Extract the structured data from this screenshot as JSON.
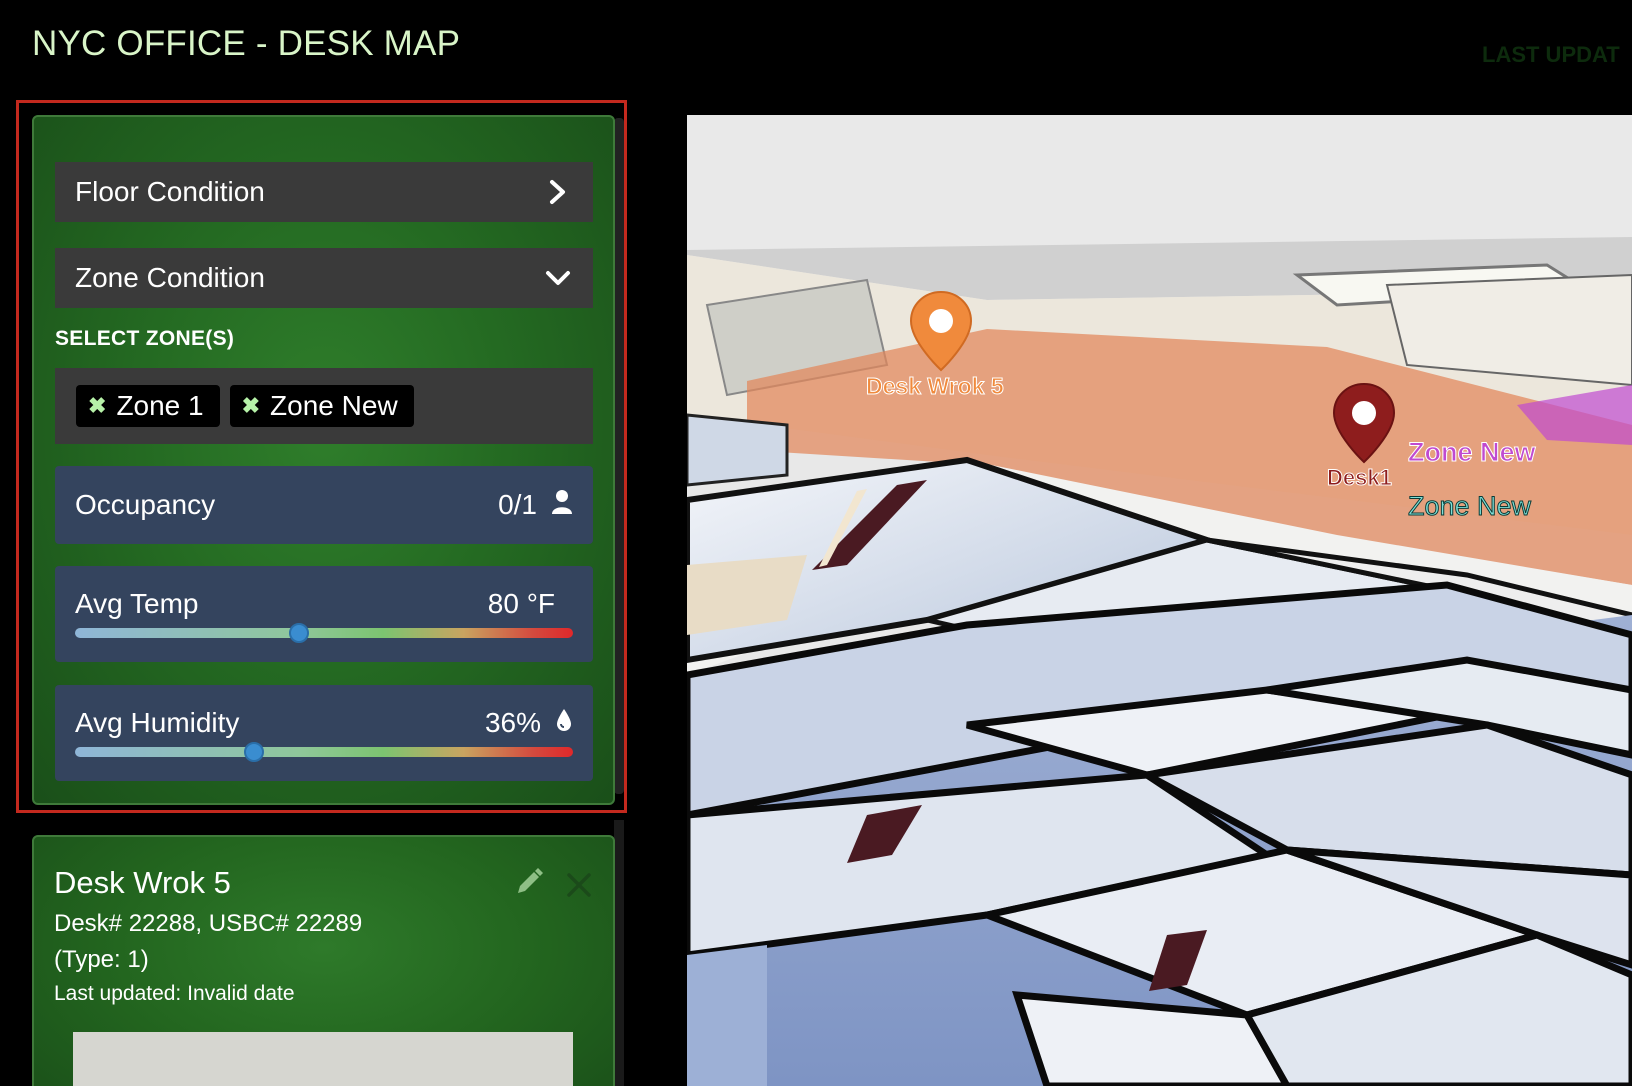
{
  "header": {
    "title": "NYC OFFICE - DESK MAP",
    "last_updated": "LAST UPDAT"
  },
  "panel": {
    "floor_condition": {
      "label": "Floor Condition",
      "icon": "chevron-right-icon",
      "expanded": false
    },
    "zone_condition": {
      "label": "Zone Condition",
      "icon": "chevron-down-icon",
      "expanded": true
    },
    "select_zones_label": "SELECT ZONE(S)",
    "selected_zones": [
      {
        "label": "Zone 1"
      },
      {
        "label": "Zone New"
      }
    ],
    "occupancy": {
      "label": "Occupancy",
      "value": "0/1",
      "icon": "user-icon"
    },
    "avg_temp": {
      "label": "Avg Temp",
      "value": "80 °F",
      "level": 0.45
    },
    "avg_humidity": {
      "label": "Avg Humidity",
      "value": "36%",
      "icon": "water-drop-icon",
      "level": 0.36
    }
  },
  "desk_card": {
    "title": "Desk Wrok 5",
    "ids": "Desk# 22288, USBC# 22289",
    "type": "(Type: 1)",
    "last_updated": "Last updated: Invalid date",
    "edit_icon": "pencil-icon",
    "close_icon": "close-icon"
  },
  "map": {
    "pins": [
      {
        "label": "Desk Wrok 5",
        "color": "#f08a3c",
        "icon": "map-pin-icon"
      },
      {
        "label": "Desk1",
        "color": "#8e1d1d",
        "icon": "map-pin-icon"
      }
    ],
    "zone_labels": [
      "Zone New",
      "Zone New"
    ],
    "colors": {
      "zone_overlay": "#e2865a",
      "zone_new_overlay": "#c04ad0",
      "accent_green": "#2f7e2b"
    }
  }
}
